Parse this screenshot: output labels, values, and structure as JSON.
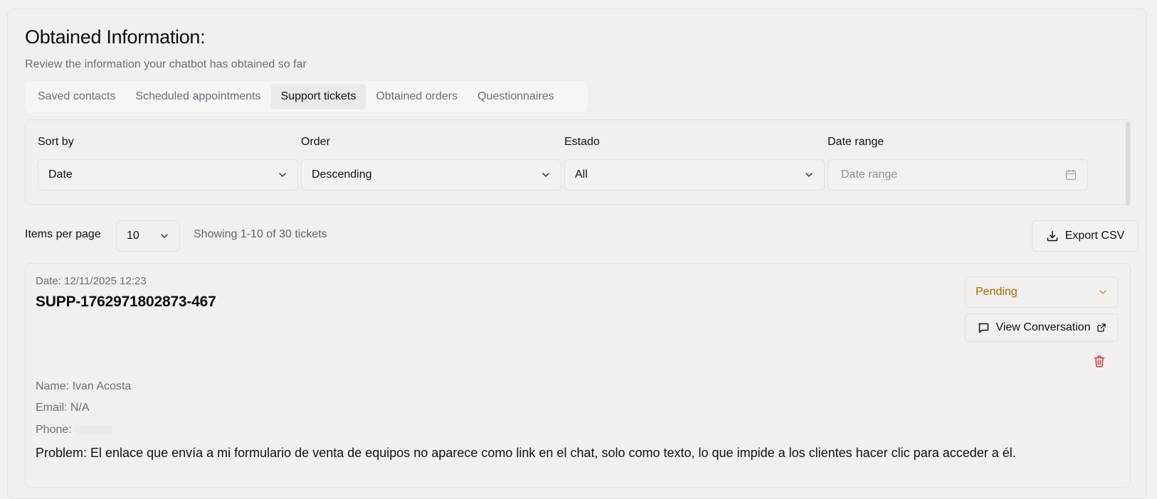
{
  "header": {
    "title": "Obtained Information:",
    "subtitle": "Review the information your chatbot has obtained so far"
  },
  "tabs": [
    {
      "label": "Saved contacts",
      "active": false
    },
    {
      "label": "Scheduled appointments",
      "active": false
    },
    {
      "label": "Support tickets",
      "active": true
    },
    {
      "label": "Obtained orders",
      "active": false
    },
    {
      "label": "Questionnaires",
      "active": false
    }
  ],
  "filters": {
    "sort_by": {
      "label": "Sort by",
      "value": "Date"
    },
    "order": {
      "label": "Order",
      "value": "Descending"
    },
    "estado": {
      "label": "Estado",
      "value": "All"
    },
    "date_range": {
      "label": "Date range",
      "placeholder": "Date range"
    }
  },
  "pagination": {
    "items_per_page_label": "Items per page",
    "items_per_page_value": "10",
    "showing_text": "Showing 1-10 of 30 tickets"
  },
  "export_label": "Export CSV",
  "ticket": {
    "date": "Date: 12/11/2025 12:23",
    "id": "SUPP-1762971802873-467",
    "status": "Pending",
    "view_conversation_label": "View Conversation",
    "name": "Name: Ivan Acosta",
    "email": "Email: N/A",
    "phone": "Phone:",
    "problem": "Problem: El enlace que envía a mi formulario de venta de equipos no aparece como link en el chat, solo como texto, lo que impide a los clientes hacer clic para acceder a él."
  },
  "colors": {
    "pending": "#a76a00",
    "delete": "#d9363e"
  },
  "icons": {
    "chevron": "chevron-down-icon",
    "calendar": "calendar-icon",
    "download": "download-icon",
    "message": "message-square-icon",
    "external": "external-link-icon",
    "trash": "trash-icon"
  }
}
